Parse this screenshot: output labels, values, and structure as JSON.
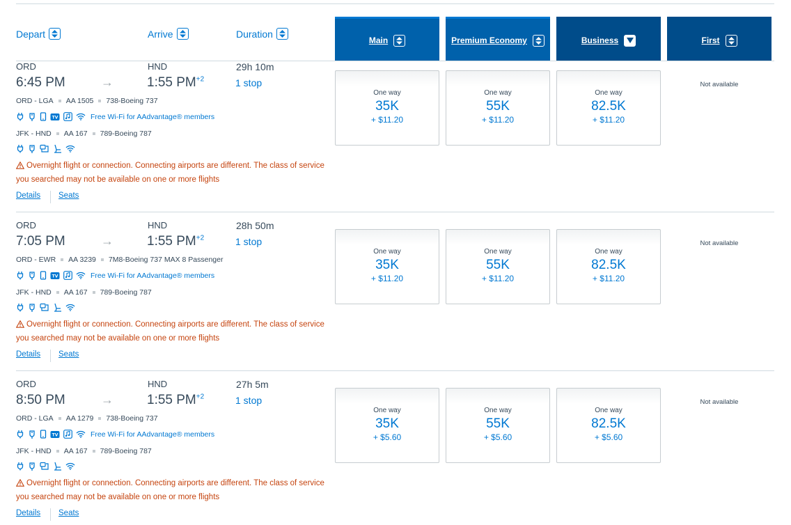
{
  "header": {
    "depart_label": "Depart",
    "arrive_label": "Arrive",
    "duration_label": "Duration",
    "cabins": [
      {
        "label": "Main"
      },
      {
        "label": "Premium Economy"
      },
      {
        "label": "Business"
      },
      {
        "label": "First"
      }
    ]
  },
  "rows": [
    {
      "origin": "ORD",
      "depart_time": "6:45 PM",
      "dest": "HND",
      "arrive_time": "1:55 PM",
      "day_offset": "+2",
      "duration": "29h 10m",
      "stops": "1 stop",
      "seg1": {
        "route": "ORD - LGA",
        "flight": "AA 1505",
        "aircraft": "738-Boeing 737"
      },
      "wifi_text": "Free Wi-Fi for AAdvantage® members",
      "seg2": {
        "route": "JFK - HND",
        "flight": "AA 167",
        "aircraft": "789-Boeing 787"
      },
      "warning": "Overnight flight or connection. Connecting airports are different. The class of service you searched may not be available on one or more flights",
      "details": "Details",
      "seats": "Seats",
      "fares": [
        {
          "label": "One way",
          "points": "35K",
          "tax": "+ $11.20"
        },
        {
          "label": "One way",
          "points": "55K",
          "tax": "+ $11.20"
        },
        {
          "label": "One way",
          "points": "82.5K",
          "tax": "+ $11.20"
        }
      ],
      "first_status": "Not available"
    },
    {
      "origin": "ORD",
      "depart_time": "7:05 PM",
      "dest": "HND",
      "arrive_time": "1:55 PM",
      "day_offset": "+2",
      "duration": "28h 50m",
      "stops": "1 stop",
      "seg1": {
        "route": "ORD - EWR",
        "flight": "AA 3239",
        "aircraft": "7M8-Boeing 737 MAX 8 Passenger"
      },
      "wifi_text": "Free Wi-Fi for AAdvantage® members",
      "seg2": {
        "route": "JFK - HND",
        "flight": "AA 167",
        "aircraft": "789-Boeing 787"
      },
      "warning": "Overnight flight or connection. Connecting airports are different. The class of service you searched may not be available on one or more flights",
      "details": "Details",
      "seats": "Seats",
      "fares": [
        {
          "label": "One way",
          "points": "35K",
          "tax": "+ $11.20"
        },
        {
          "label": "One way",
          "points": "55K",
          "tax": "+ $11.20"
        },
        {
          "label": "One way",
          "points": "82.5K",
          "tax": "+ $11.20"
        }
      ],
      "first_status": "Not available"
    },
    {
      "origin": "ORD",
      "depart_time": "8:50 PM",
      "dest": "HND",
      "arrive_time": "1:55 PM",
      "day_offset": "+2",
      "duration": "27h 5m",
      "stops": "1 stop",
      "seg1": {
        "route": "ORD - LGA",
        "flight": "AA 1279",
        "aircraft": "738-Boeing 737"
      },
      "wifi_text": "Free Wi-Fi for AAdvantage® members",
      "seg2": {
        "route": "JFK - HND",
        "flight": "AA 167",
        "aircraft": "789-Boeing 787"
      },
      "warning": "Overnight flight or connection. Connecting airports are different. The class of service you searched may not be available on one or more flights",
      "details": "Details",
      "seats": "Seats",
      "fares": [
        {
          "label": "One way",
          "points": "35K",
          "tax": "+ $5.60"
        },
        {
          "label": "One way",
          "points": "55K",
          "tax": "+ $5.60"
        },
        {
          "label": "One way",
          "points": "82.5K",
          "tax": "+ $5.60"
        }
      ],
      "first_status": "Not available"
    }
  ],
  "colors": {
    "accent": "#0078d2",
    "header_blue": "#0061ab",
    "header_dark": "#004c8a",
    "warning": "#c5440f"
  }
}
